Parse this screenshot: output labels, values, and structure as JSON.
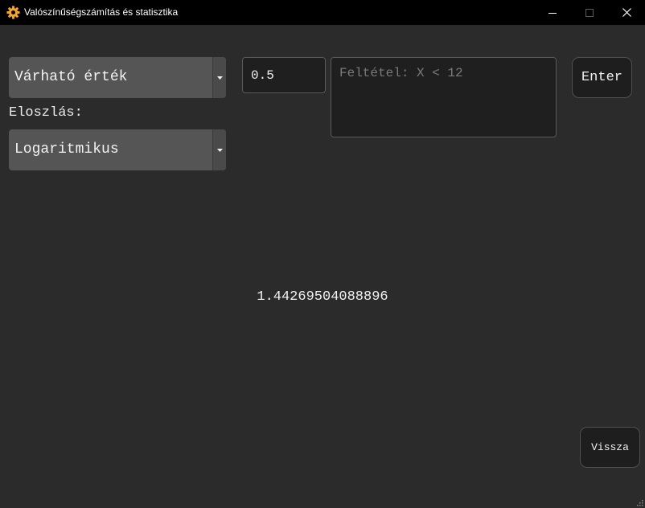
{
  "window": {
    "title": "Valószínűségszámítás és statisztika",
    "icon": "gear-icon",
    "accent_color": "#f5a623"
  },
  "controls": {
    "mode_select": {
      "value": "Várható érték"
    },
    "distribution_label": "Eloszlás:",
    "distribution_select": {
      "value": "Logaritmikus"
    },
    "parameter_input": {
      "value": "0.5"
    },
    "condition_input": {
      "value": "",
      "placeholder": "Feltétel: X < 12"
    },
    "enter_button": "Enter",
    "back_button": "Vissza"
  },
  "result": {
    "value": "1.44269504088896"
  }
}
